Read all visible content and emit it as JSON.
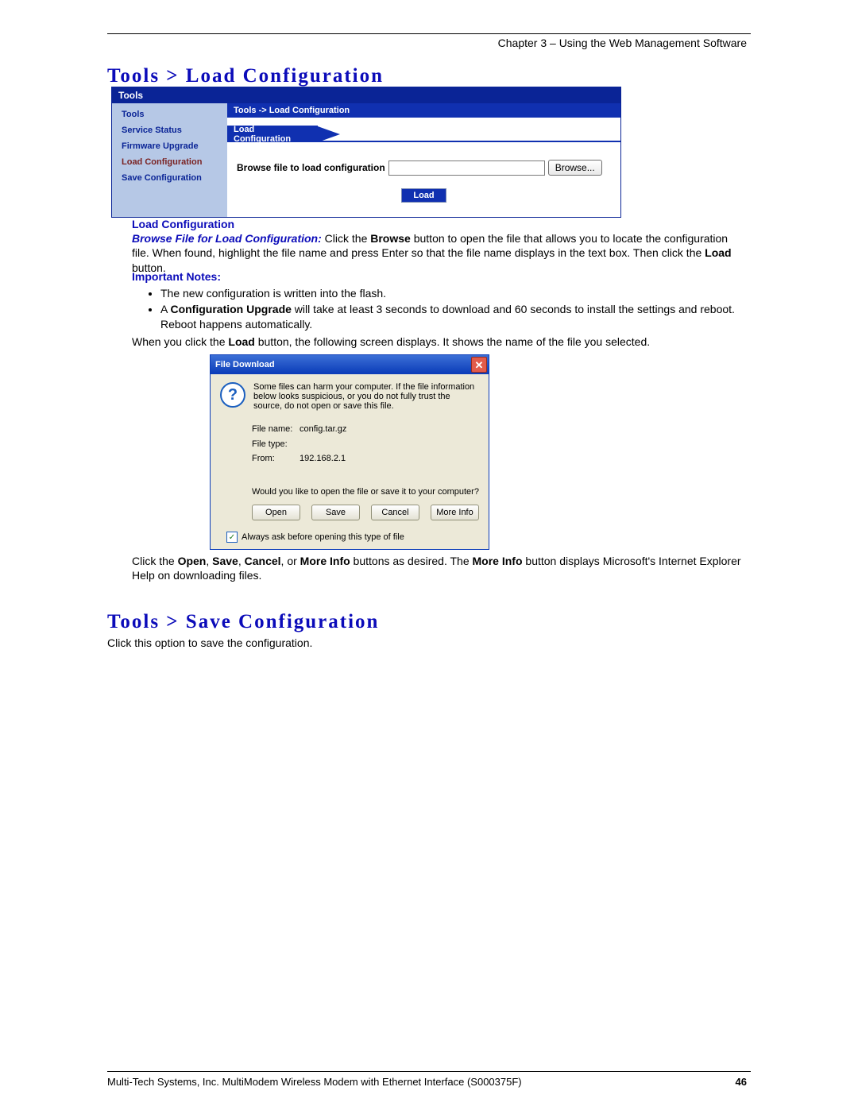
{
  "header": {
    "chapter": "Chapter 3 – Using the Web Management Software"
  },
  "section1": {
    "title": "Tools > Load Configuration"
  },
  "ui": {
    "nav_header": "Tools",
    "nav_items": [
      "Tools",
      "Service Status",
      "Firmware Upgrade",
      "Load Configuration",
      "Save Configuration"
    ],
    "breadcrumb": "Tools  ->  Load Configuration",
    "section_label": "Load Configuration",
    "form_label": "Browse file to load configuration",
    "browse_btn": "Browse...",
    "load_btn": "Load"
  },
  "body": {
    "subhead1": "Load Configuration",
    "para1_lead": "Browse File for Load Configuration:",
    "para1_rest_a": " Click the ",
    "para1_b1": "Browse",
    "para1_rest_b": " button to open the file that allows you to locate the configuration file. When found, highlight the file name and press Enter so that the file name displays in the text box. Then click the ",
    "para1_b2": "Load",
    "para1_rest_c": " button.",
    "notes_head": "Important Notes",
    "note1": "The new configuration is written into the flash.",
    "note2_a": "A ",
    "note2_b": "Configuration Upgrade",
    "note2_c": " will take at least 3 seconds to download and 60 seconds to install the settings and reboot. Reboot happens automatically.",
    "after_notes_a": "When you click the ",
    "after_notes_b": "Load",
    "after_notes_c": " button, the following screen displays. It shows the name of the file you selected.",
    "after_dialog_a": "Click the ",
    "after_dialog_b1": "Open",
    "after_dialog_sep": ", ",
    "after_dialog_b2": "Save",
    "after_dialog_b3": "Cancel",
    "after_dialog_or": ", or ",
    "after_dialog_b4": "More Info",
    "after_dialog_mid": " buttons as desired. The ",
    "after_dialog_b5": "More Info",
    "after_dialog_end": " button displays Microsoft's Internet Explorer Help on downloading files."
  },
  "dialog": {
    "title": "File Download",
    "warning": "Some files can harm your computer. If the file information below looks suspicious, or you do not fully trust the source, do not open or save this file.",
    "filename_label": "File name:",
    "filename_value": "config.tar.gz",
    "filetype_label": "File type:",
    "filetype_value": "",
    "from_label": "From:",
    "from_value": "192.168.2.1",
    "prompt": "Would you like to open the file or save it to your computer?",
    "buttons": [
      "Open",
      "Save",
      "Cancel",
      "More Info"
    ],
    "checkbox_label": "Always ask before opening this type of file"
  },
  "section2": {
    "title": "Tools > Save Configuration",
    "para": "Click this option to save the configuration."
  },
  "footer": {
    "text": "Multi-Tech Systems, Inc. MultiModem Wireless Modem with Ethernet Interface (S000375F)",
    "page": "46"
  }
}
